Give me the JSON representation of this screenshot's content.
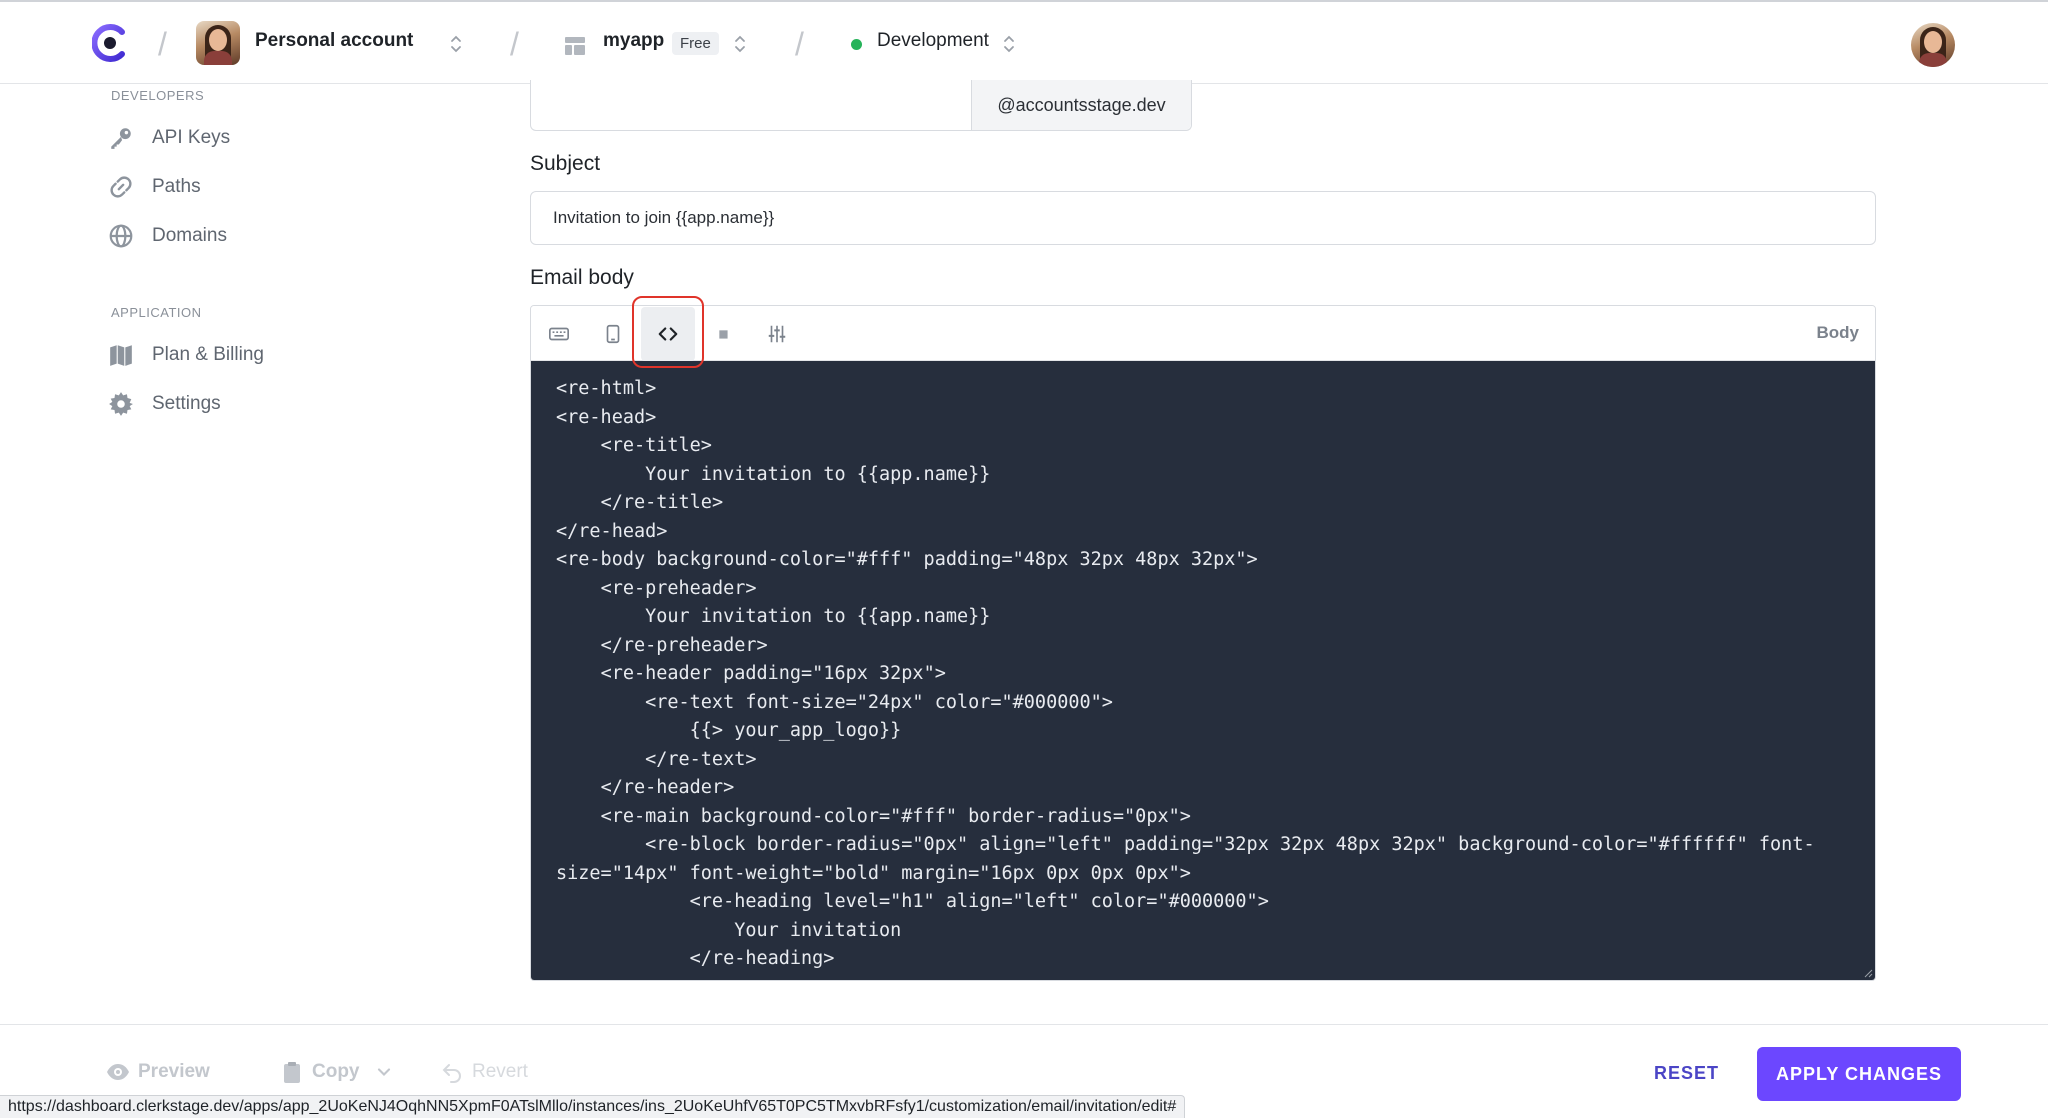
{
  "topbar": {
    "account_name": "Personal account",
    "app_name": "myapp",
    "plan_badge": "Free",
    "environment": "Development",
    "environment_color": "#26b35a"
  },
  "sidebar": {
    "developers_heading": "DEVELOPERS",
    "developers_items": [
      {
        "label": "API Keys",
        "icon": "key-icon"
      },
      {
        "label": "Paths",
        "icon": "link-icon"
      },
      {
        "label": "Domains",
        "icon": "globe-icon"
      }
    ],
    "application_heading": "APPLICATION",
    "application_items": [
      {
        "label": "Plan & Billing",
        "icon": "map-icon"
      },
      {
        "label": "Settings",
        "icon": "gear-icon"
      }
    ]
  },
  "form": {
    "from_suffix": "@accountsstage.dev",
    "subject_label": "Subject",
    "subject_value": "Invitation to join {{app.name}}",
    "email_body_label": "Email body",
    "editor_tag": "Body",
    "code": "<re-html>\n<re-head>\n    <re-title>\n        Your invitation to {{app.name}}\n    </re-title>\n</re-head>\n<re-body background-color=\"#fff\" padding=\"48px 32px 48px 32px\">\n    <re-preheader>\n        Your invitation to {{app.name}}\n    </re-preheader>\n    <re-header padding=\"16px 32px\">\n        <re-text font-size=\"24px\" color=\"#000000\">\n            {{> your_app_logo}}\n        </re-text>\n    </re-header>\n    <re-main background-color=\"#fff\" border-radius=\"0px\">\n        <re-block border-radius=\"0px\" align=\"left\" padding=\"32px 32px 48px 32px\" background-color=\"#ffffff\" font-size=\"14px\" font-weight=\"bold\" margin=\"16px 0px 0px 0px\">\n            <re-heading level=\"h1\" align=\"left\" color=\"#000000\">\n                Your invitation\n            </re-heading>"
  },
  "footer": {
    "preview_label": "Preview",
    "copy_label": "Copy",
    "revert_label": "Revert",
    "reset_label": "RESET",
    "apply_label": "APPLY CHANGES",
    "accent_color": "#6c47ff"
  },
  "statusbar": {
    "url": "https://dashboard.clerkstage.dev/apps/app_2UoKeNJ4OqhNN5XpmF0ATslMllo/instances/ins_2UoKeUhfV65T0PC5TMxvbRFsfy1/customization/email/invitation/edit#"
  }
}
